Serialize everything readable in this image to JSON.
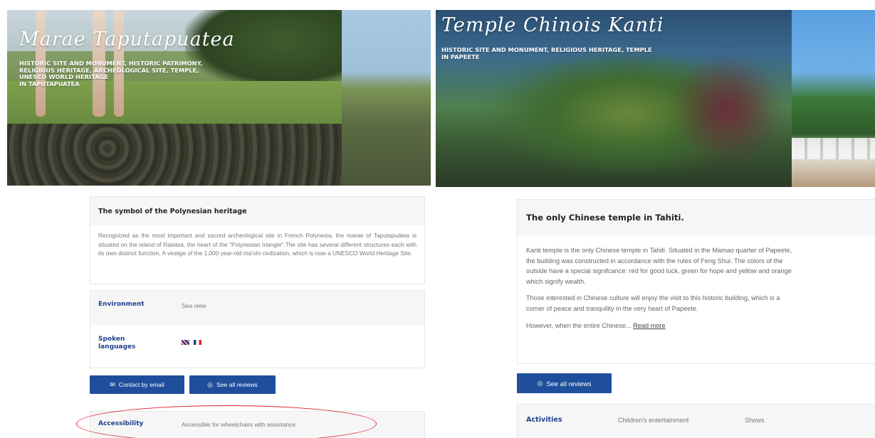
{
  "left": {
    "hero": {
      "title": "Marae Taputapuatea",
      "subtitle_lines": [
        "HISTORIC SITE AND MONUMENT, HISTORIC PATRIMONY,",
        "RELIGIOUS HERITAGE, ARCHEOLOGICAL SITE, TEMPLE,",
        "UNESCO WORLD HERITAGE",
        "IN TAPUTAPUATEA"
      ]
    },
    "description": {
      "heading": "The symbol of the Polynesian heritage",
      "text": "Recognized as the most important and sacred archeological site in French Polynesia, the marae of Taputapuātea is situated on the island of Raiatea, the heart of the \"Polynesian triangle\".The site has several different structures each with its own distinct function. A vestige of the 1,000 year-old mā'ohi civilization, which is now a UNESCO World Heritage Site."
    },
    "info": {
      "environment_label": "Environment",
      "environment_value": "Sea view",
      "languages_label_1": "Spoken",
      "languages_label_2": "languages",
      "languages": [
        "English",
        "French"
      ]
    },
    "buttons": {
      "contact_label": "Contact by email",
      "reviews_label": "See all reviews"
    },
    "accessibility": {
      "label": "Accessibility",
      "value": "Accessible for wheelchairs with assistance"
    }
  },
  "right": {
    "hero": {
      "title": "Temple Chinois Kanti",
      "subtitle_lines": [
        "HISTORIC SITE AND MONUMENT, RELIGIOUS HERITAGE, TEMPLE",
        "IN PAPEETE"
      ]
    },
    "description": {
      "heading": "The only Chinese temple in Tahiti.",
      "para1_lines": [
        "Kanti temple is the only Chinese temple in Tahiti. Situated in the Mamao quarter of Papeete,",
        "the building was constructed in accordance with the rules of Feng Shui. The colors of the",
        "outside have a special signifcance: red for good luck, green for hope and yellow and orange",
        "which signify wealth."
      ],
      "para2_lines": [
        "Those interested in Chinese culture will enjoy the visit to this historic building, which is a",
        "corner of peace and tranquility in the very heart of Papeete."
      ],
      "para3_text": "However, when the entire Chinese...",
      "read_more": "Read more"
    },
    "buttons": {
      "reviews_label": "See all reviews"
    },
    "activities": {
      "label": "Activities",
      "values": [
        "Children's entertainment",
        "Shows"
      ]
    }
  },
  "colors": {
    "accent_blue": "#1f4f9c",
    "label_blue": "#23408e",
    "highlight_red": "#d9262e"
  }
}
